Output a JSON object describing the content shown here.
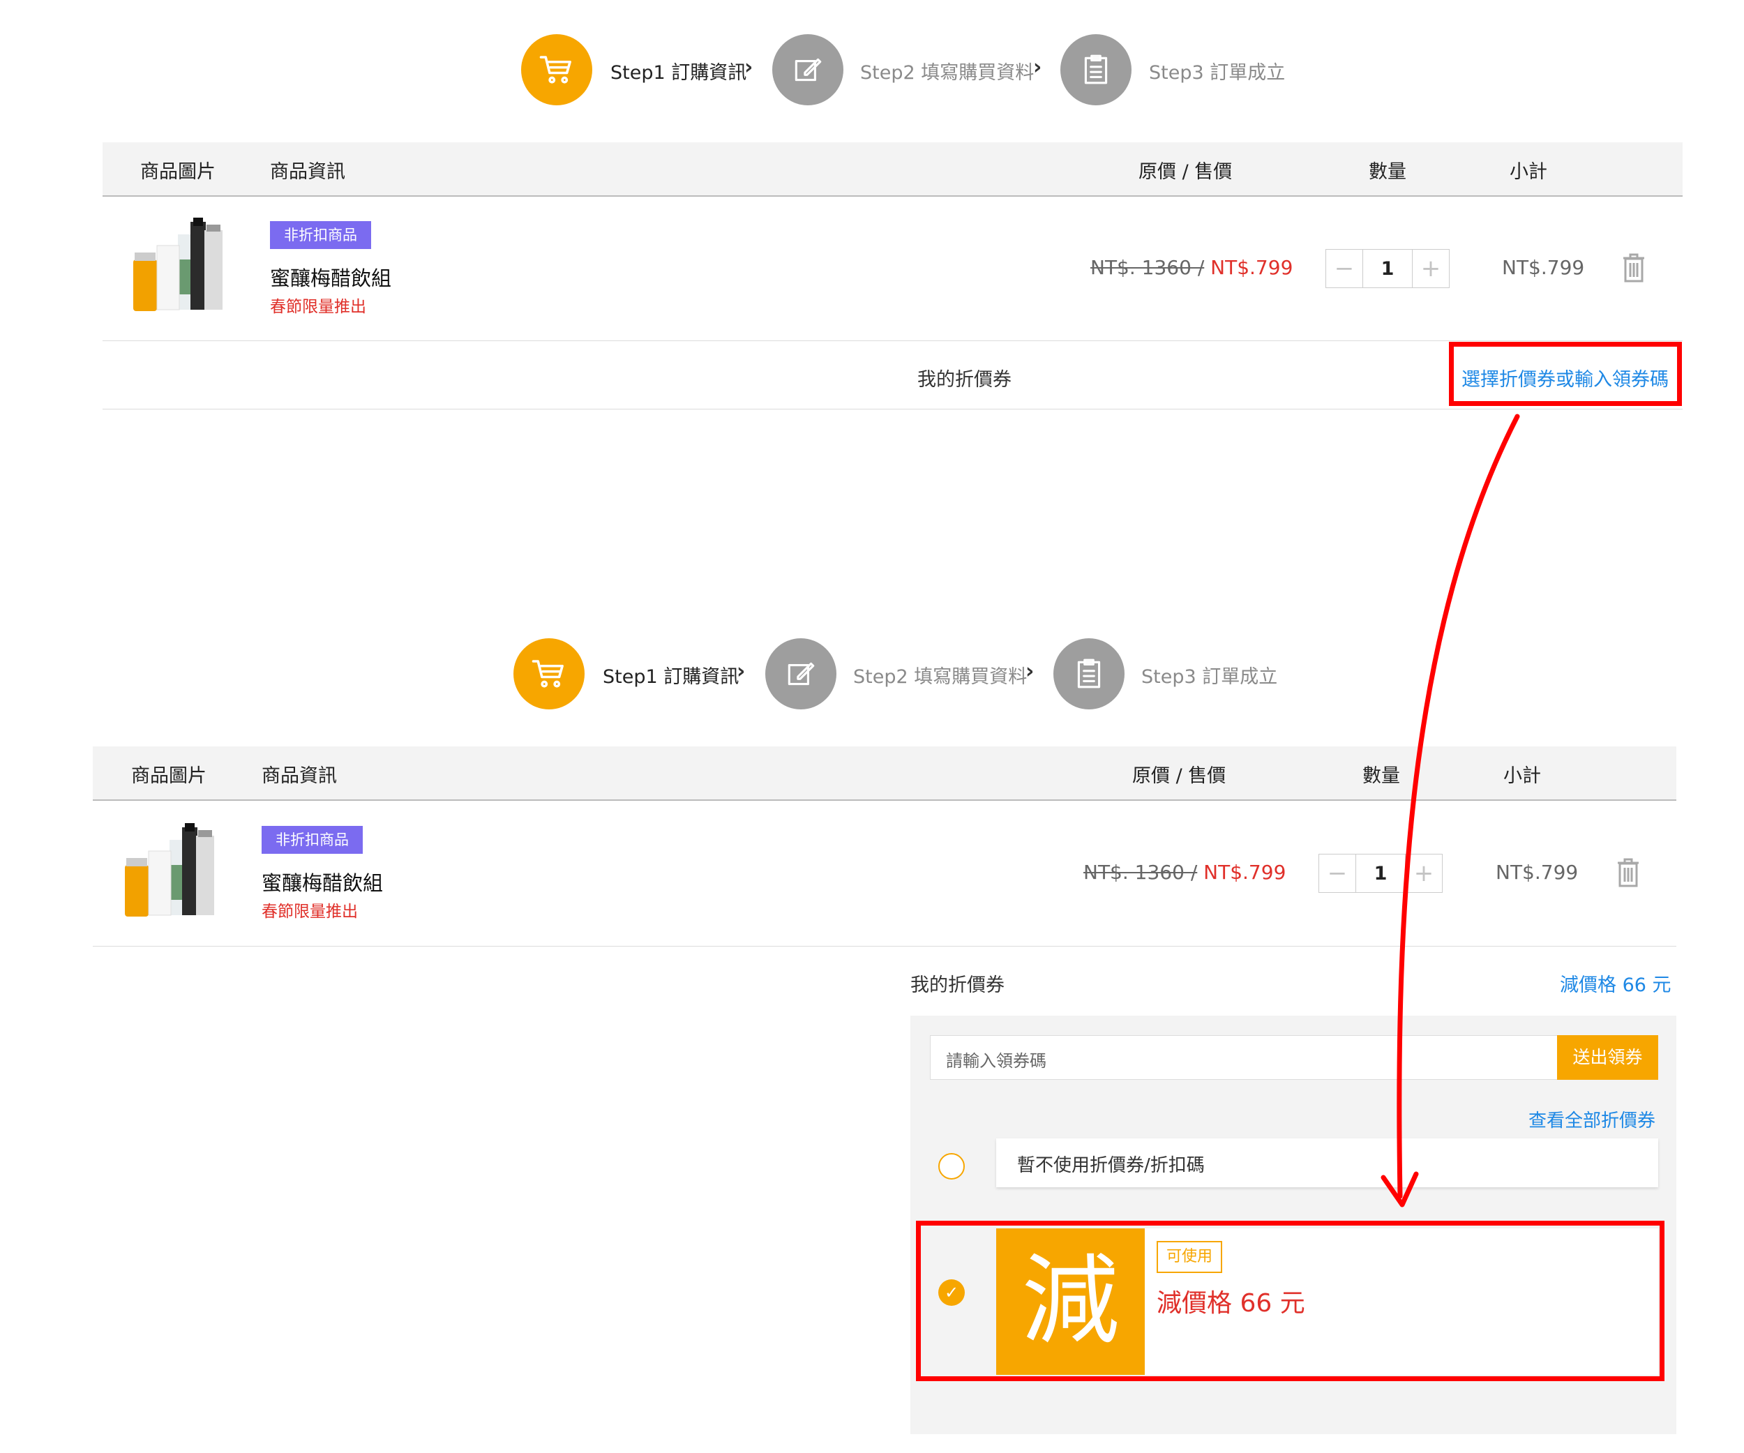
{
  "steps": [
    {
      "label": "Step1 訂購資訊",
      "active": true
    },
    {
      "label": "Step2 填寫購買資料",
      "active": false
    },
    {
      "label": "Step3 訂單成立",
      "active": false
    }
  ],
  "table_headers": {
    "image": "商品圖片",
    "info": "商品資訊",
    "price": "原價 / 售價",
    "qty": "數量",
    "subtotal": "小計"
  },
  "product": {
    "tag": "非折扣商品",
    "name": "蜜釀梅醋飲組",
    "note": "春節限量推出",
    "original_price": "NT$. 1360 /",
    "sale_price": "NT$.799",
    "quantity": "1",
    "subtotal": "NT$.799"
  },
  "coupon_section": {
    "label": "我的折價券",
    "select_link": "選擇折價券或輸入領券碼",
    "applied": "減價格 66 元"
  },
  "coupon_panel": {
    "input_placeholder": "請輸入領券碼",
    "submit": "送出領券",
    "view_all": "查看全部折價券",
    "no_coupon": "暫不使用折價券/折扣碼",
    "coupon_badge_char": "減",
    "coupon_status": "可使用",
    "coupon_title": "減價格 66 元"
  },
  "colors": {
    "accent": "#f7a600",
    "tag": "#7b6bf0",
    "sale": "#e0302a",
    "link": "#1e88e5",
    "annotation": "#ff0000"
  }
}
